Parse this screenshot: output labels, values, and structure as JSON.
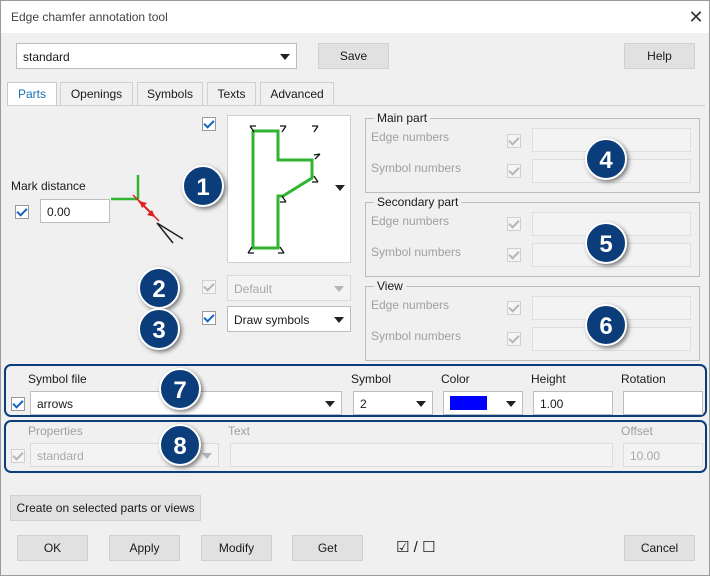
{
  "window": {
    "title": "Edge chamfer annotation tool"
  },
  "top": {
    "preset": "standard",
    "save": "Save",
    "help": "Help"
  },
  "tabs": [
    "Parts",
    "Openings",
    "Symbols",
    "Texts",
    "Advanced"
  ],
  "parts": {
    "mark_distance_label": "Mark distance",
    "mark_distance_value": "0.00",
    "auto_combo": "Default",
    "draw_combo": "Draw symbols",
    "main_part": {
      "title": "Main part",
      "edge_numbers": "Edge numbers",
      "symbol_numbers": "Symbol numbers"
    },
    "secondary_part": {
      "title": "Secondary part",
      "edge_numbers": "Edge numbers",
      "symbol_numbers": "Symbol numbers"
    },
    "view": {
      "title": "View",
      "edge_numbers": "Edge numbers",
      "symbol_numbers": "Symbol numbers"
    }
  },
  "symbol_row": {
    "symbol_file_label": "Symbol file",
    "symbol_file_value": "arrows",
    "symbol_label": "Symbol",
    "symbol_value": "2",
    "color_label": "Color",
    "color_value": "#0000ff",
    "height_label": "Height",
    "height_value": "1.00",
    "rotation_label": "Rotation",
    "rotation_value": ""
  },
  "properties_row": {
    "properties_label": "Properties",
    "properties_value": "standard",
    "text_label": "Text",
    "offset_label": "Offset",
    "offset_value": "10.00"
  },
  "badges": [
    "1",
    "2",
    "3",
    "4",
    "5",
    "6",
    "7",
    "8"
  ],
  "bottom": {
    "create": "Create on selected parts or views",
    "ok": "OK",
    "apply": "Apply",
    "modify": "Modify",
    "get": "Get",
    "toggle": "☑ / ☐",
    "cancel": "Cancel"
  },
  "colors": {
    "accent": "#1565c0",
    "badge": "#0b3d7a",
    "shape": "#2fb52f",
    "dim": "#e02020"
  }
}
